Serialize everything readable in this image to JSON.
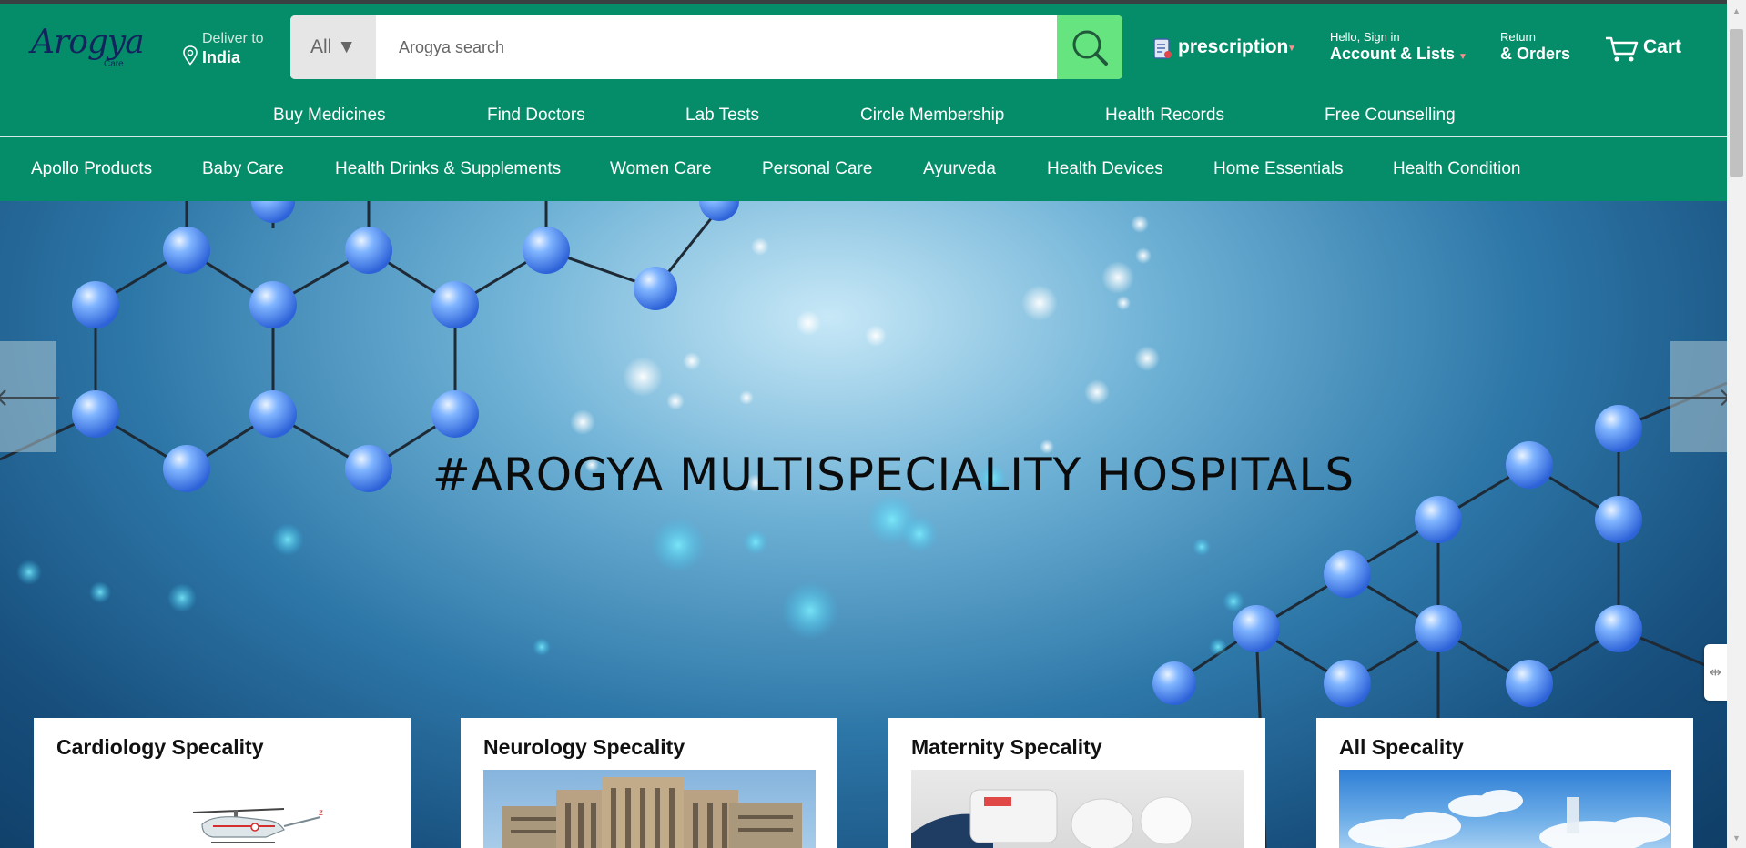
{
  "brand": {
    "logo_text": "Arogya",
    "logo_sub": "Care"
  },
  "deliver": {
    "line1": "Deliver to",
    "line2": "India"
  },
  "search": {
    "category": "All",
    "placeholder": "Arogya search"
  },
  "header_links": {
    "prescription": "prescription",
    "account_line1": "Hello, Sign in",
    "account_line2": "Account & Lists",
    "orders_line1": "Return",
    "orders_line2": "& Orders",
    "cart": "Cart"
  },
  "primary_nav": [
    "Buy Medicines",
    "Find Doctors",
    "Lab Tests",
    "Circle Membership",
    "Health Records",
    "Free Counselling"
  ],
  "categories": [
    "Apollo Products",
    "Baby Care",
    "Health Drinks & Supplements",
    "Women Care",
    "Personal Care",
    "Ayurveda",
    "Health Devices",
    "Home Essentials",
    "Health Condition"
  ],
  "hero": {
    "headline": "#AROGYA MULTISPECIALITY HOSPITALS"
  },
  "cards": [
    {
      "title": "Cardiology Specality"
    },
    {
      "title": "Neurology Specality"
    },
    {
      "title": "Maternity Specality"
    },
    {
      "title": "All Specality"
    }
  ],
  "colors": {
    "header_bg": "#058d69",
    "search_button": "#66e47f",
    "logo": "#12245e"
  }
}
